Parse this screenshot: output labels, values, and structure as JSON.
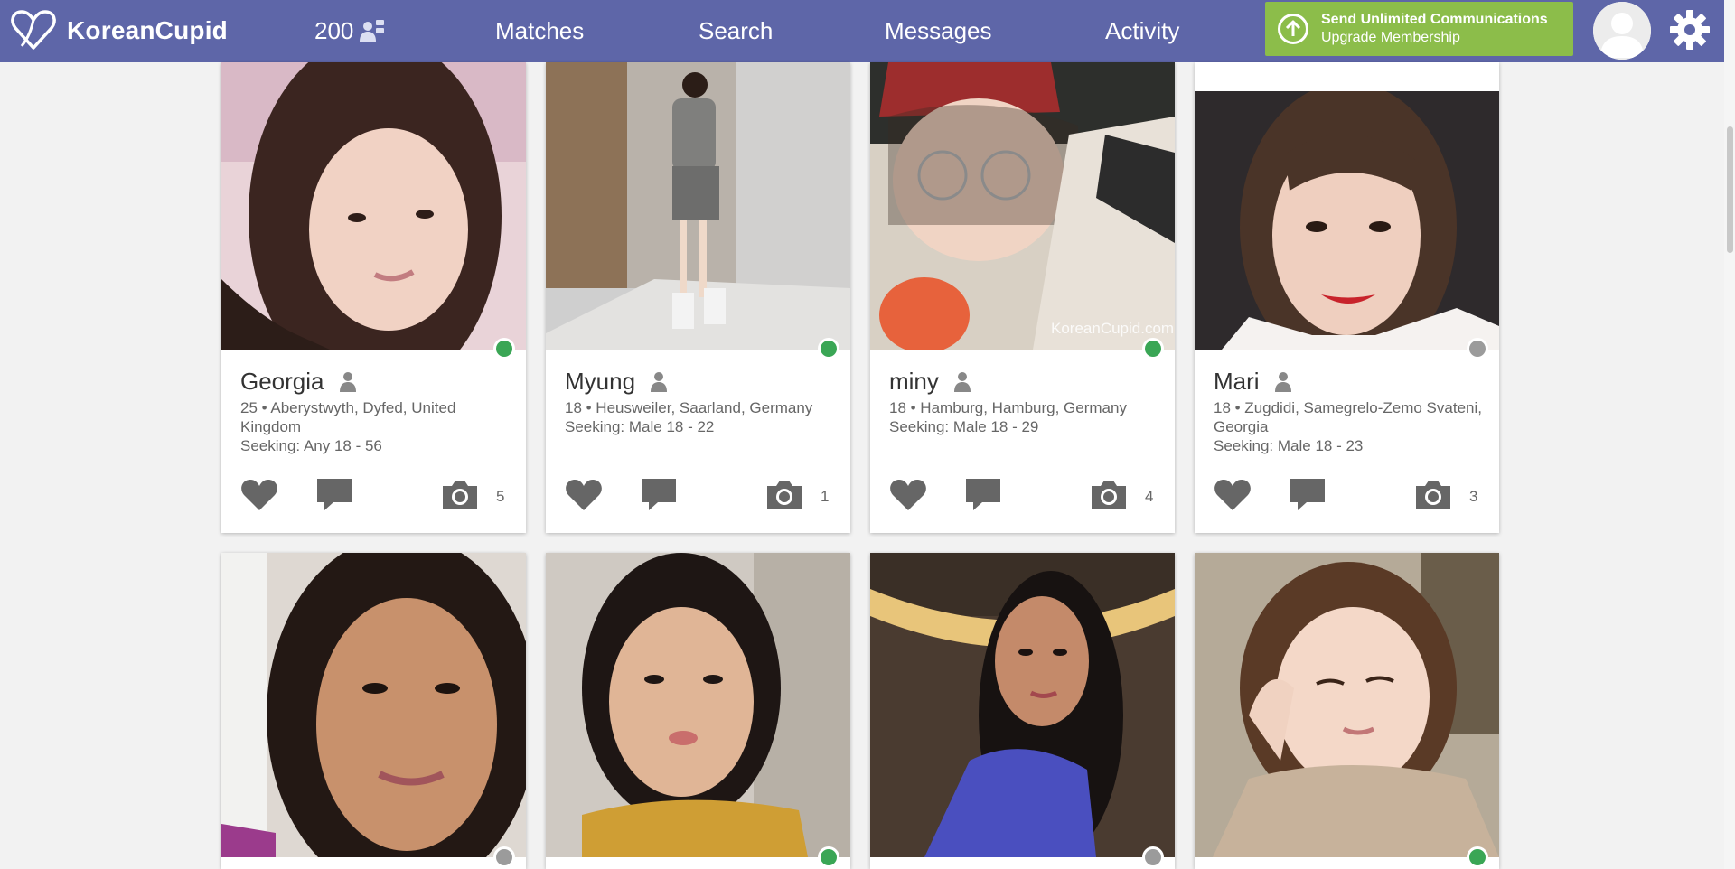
{
  "header": {
    "logo_text": "KoreanCupid",
    "count": "200",
    "nav": [
      "Matches",
      "Search",
      "Messages",
      "Activity"
    ],
    "upgrade_line1": "Send Unlimited Communications",
    "upgrade_line2": "Upgrade Membership"
  },
  "colors": {
    "nav_bg": "#5e66a8",
    "upgrade_green": "#8cbd4a",
    "online": "#3aa655",
    "offline": "#9b9b9b",
    "icon_grey": "#666666"
  },
  "profiles": [
    {
      "name": "Georgia",
      "location": "25 • Aberystwyth, Dyfed, United Kingdom",
      "seeking": "Seeking: Any 18 - 56",
      "photos": "5",
      "online": true
    },
    {
      "name": "Myung",
      "location": "18 • Heusweiler, Saarland, Germany",
      "seeking": "Seeking: Male 18 - 22",
      "photos": "1",
      "online": true
    },
    {
      "name": "miny",
      "location": "18 • Hamburg, Hamburg, Germany",
      "seeking": "Seeking: Male 18 - 29",
      "photos": "4",
      "online": true
    },
    {
      "name": "Mari",
      "location": "18 • Zugdidi, Samegrelo-Zemo Svateni, Georgia",
      "seeking": "Seeking: Male 18 - 23",
      "photos": "3",
      "online": false
    }
  ],
  "second_row_status": [
    "offline",
    "online",
    "offline",
    "online"
  ],
  "watermark": "KoreanCupid.com",
  "icons": [
    "heart-logo-icon",
    "people-icon",
    "upload-arrow-icon",
    "person-icon",
    "heart-icon",
    "chat-bubble-icon",
    "camera-icon",
    "gear-icon"
  ]
}
